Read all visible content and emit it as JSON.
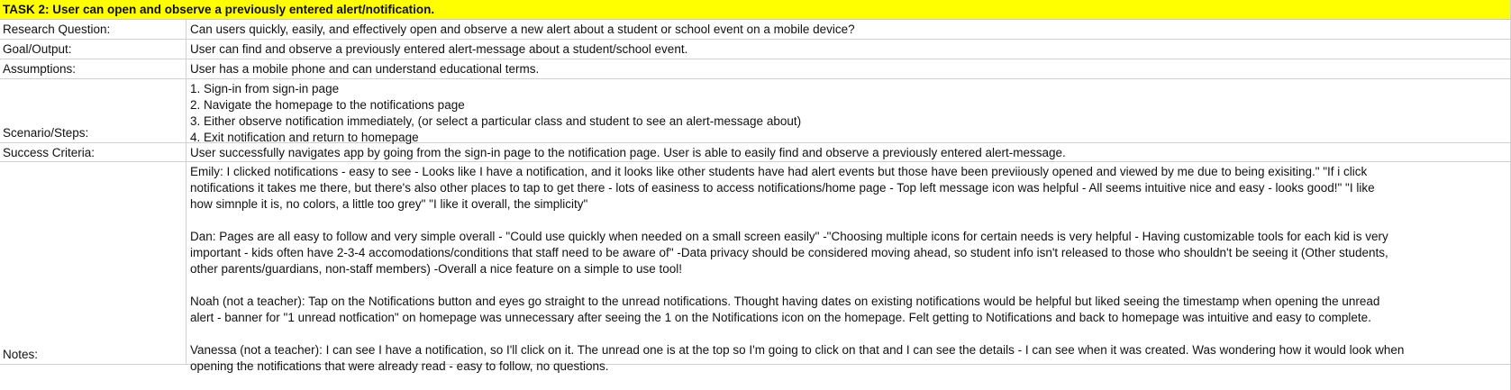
{
  "task_title": "TASK 2: User can open and observe a previously entered alert/notification.",
  "rows": {
    "research": {
      "label": "Research Question:",
      "value": "Can users quickly, easily, and effectively open and observe a new alert about a student or school event on a mobile device?"
    },
    "goal": {
      "label": "Goal/Output:",
      "value": "User can find and observe a previously entered alert-message about a student/school event."
    },
    "assumptions": {
      "label": "Assumptions:",
      "value": "User has a mobile phone and can understand educational terms."
    },
    "scenario": {
      "label": "Scenario/Steps:",
      "steps": [
        "1. Sign-in from sign-in page",
        "2. Navigate the homepage to the notifications page",
        "3. Either observe notification immediately, (or select a particular class and student to see an alert-message about)",
        "4. Exit notification and return to homepage"
      ]
    },
    "success": {
      "label": "Success Criteria:",
      "value": "User successfully navigates app by going from the sign-in page to the notification page. User is able to easily find and observe a previously entered alert-message."
    },
    "notes": {
      "label": "Notes:",
      "paragraphs": [
        [
          "Emily: I clicked notifications - easy to see - Looks like I have a notification, and it looks like other students have had alert events but those have been previiously opened and viewed by me due to being exisiting.\" \"If i click",
          "notifications it takes me there, but there's also other places to tap to get there - lots of easiness to access notifications/home page - Top left message icon was helpful - All seems intuitive nice and easy - looks good!\" \"I like",
          "how simnple it is, no colors, a little too grey\" \"I like it overall, the simplicity\""
        ],
        [
          "Dan: Pages are all easy to follow and very simple overall - \"Could use quickly when needed on a small screen easily\" -\"Choosing multiple icons for certain needs is very helpful - Having customizable tools for each kid is very",
          "important - kids often have 2-3-4 accomodations/conditions that staff need to be aware of\" -Data privacy should be considered moving ahead, so student info isn't released to those who shouldn't be seeing it (Other students,",
          "other parents/guardians, non-staff members) -Overall a nice feature on a simple to use tool!"
        ],
        [
          "Noah (not a teacher): Tap on the Notifications button and eyes go straight to the unread notifications. Thought having dates on existing notifications would be helpful but liked seeing the timestamp when opening the unread",
          "alert - banner for \"1 unread notfication\" on homepage was unnecessary after seeing the 1 on the Notifications icon on the homepage. Felt getting to Notifications and back to homepage was intuitive and easy to complete."
        ],
        [
          "Vanessa (not a teacher): I can see I have a notification, so I'll click on it. The unread one is at the top so I'm going to click on that and I can see the details - I can see when it was created. Was wondering how it would look when",
          "opening the notifications that were already read - easy to follow, no questions."
        ]
      ]
    }
  },
  "colors": {
    "header_fill": "#ffff00",
    "grid_line": "#d0d0d0"
  }
}
